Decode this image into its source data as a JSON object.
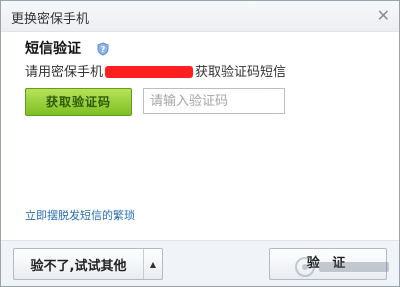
{
  "dialog": {
    "title": "更换密保手机",
    "close_icon": "close-icon"
  },
  "sms": {
    "heading": "短信验证",
    "shield_icon": "shield-question-icon",
    "desc_prefix": "请用密保手机",
    "desc_suffix": "获取验证码短信",
    "get_code_label": "获取验证码",
    "code_placeholder": "请输入验证码",
    "code_value": "",
    "escape_link": "立即摆脱发短信的繁琐"
  },
  "footer": {
    "other_label": "验不了,试试其他",
    "dropdown_icon": "triangle-up-icon",
    "verify_label": "验 证"
  },
  "colors": {
    "accent_green": "#8cc63f",
    "link_blue": "#2a6db5",
    "redaction": "#ff1f1f"
  }
}
